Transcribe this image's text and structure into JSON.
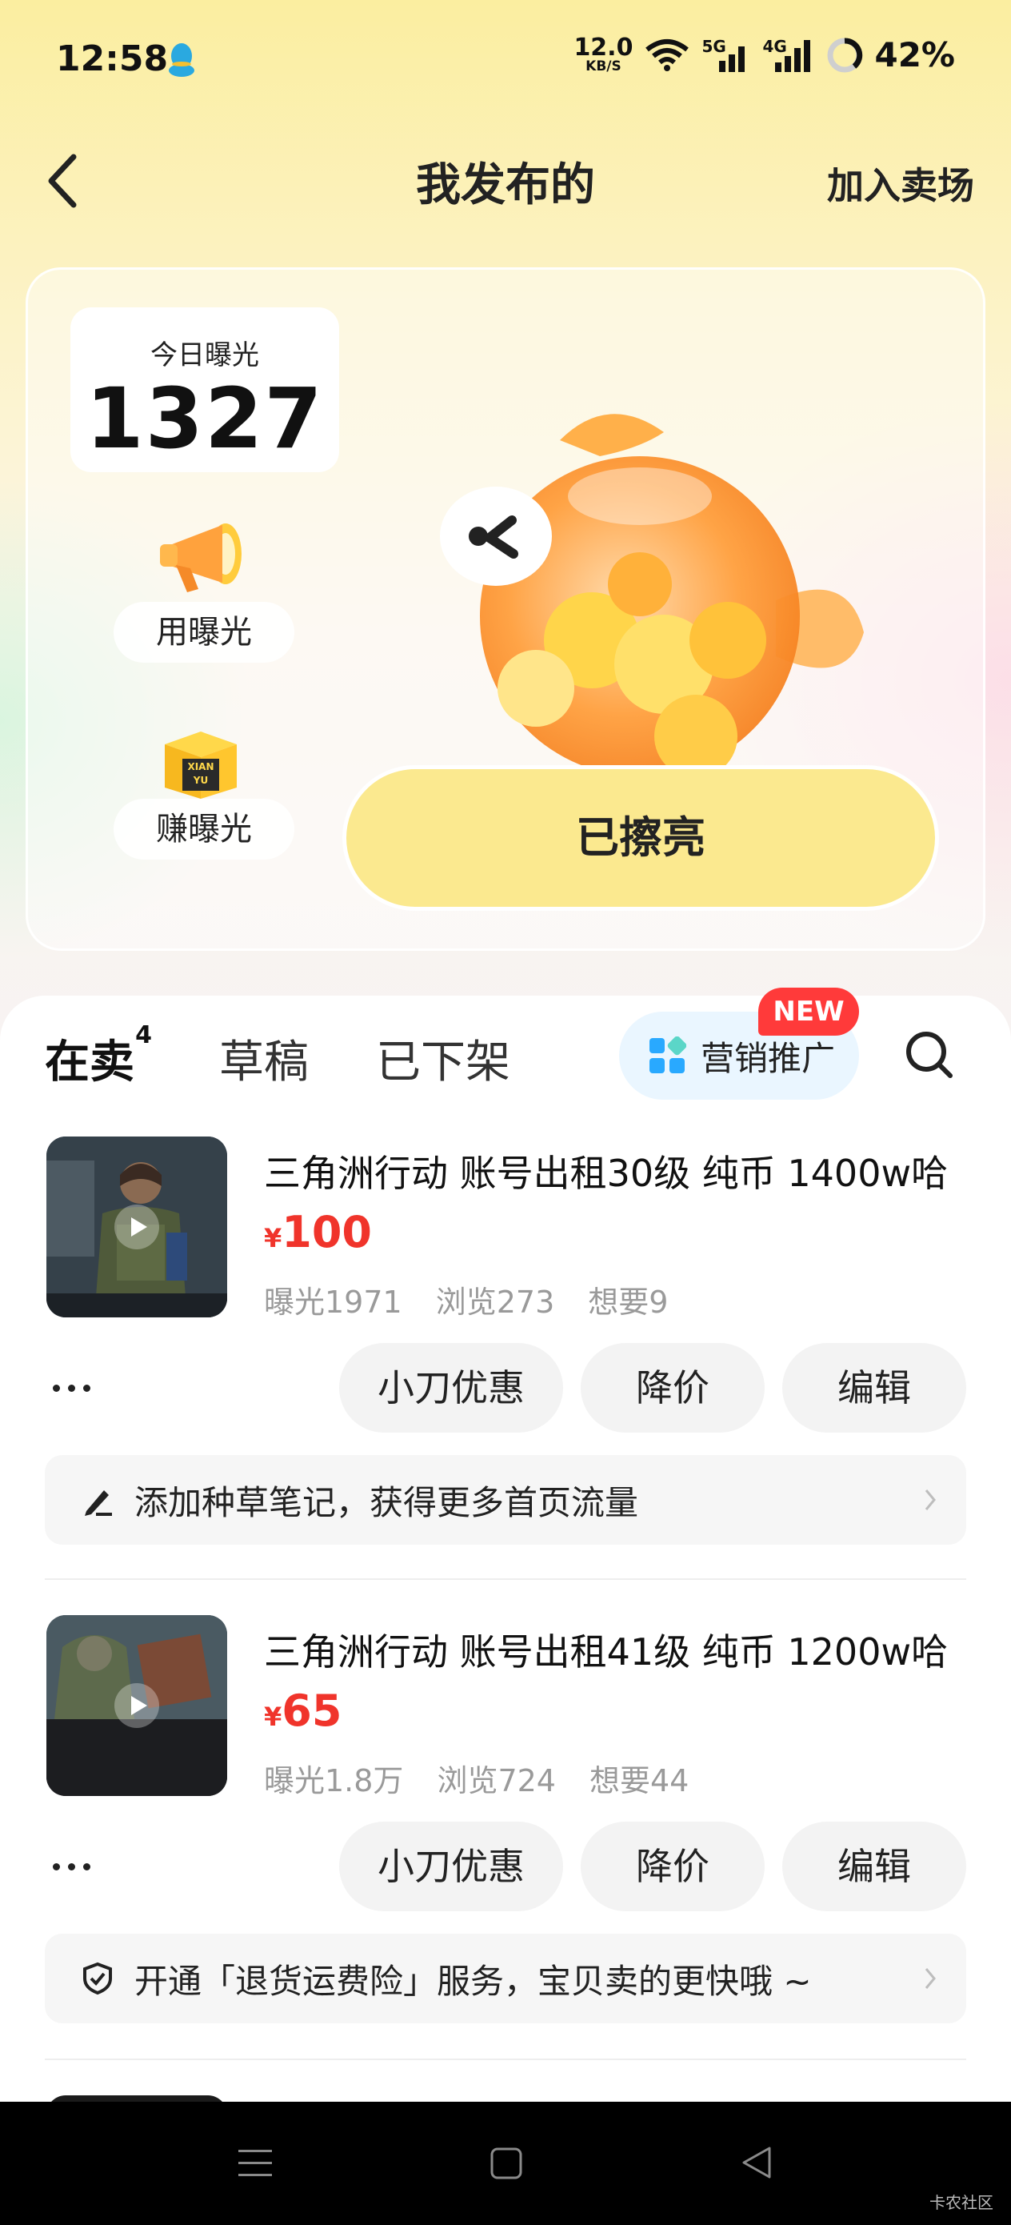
{
  "status_bar": {
    "time": "12:58",
    "net_speed_value": "12.0",
    "net_speed_unit": "KB/S",
    "signal1_label": "5G",
    "signal2_label": "4G",
    "battery": "42%"
  },
  "header": {
    "title": "我发布的",
    "join_label": "加入卖场"
  },
  "hero": {
    "today_exposure_label": "今日曝光",
    "today_exposure_value": "1327",
    "use_exposure_label": "用曝光",
    "earn_exposure_label": "赚曝光",
    "box_logo_line1": "XIAN",
    "box_logo_line2": "YU",
    "polish_button_label": "已擦亮"
  },
  "tabs": {
    "on_sale_label": "在卖",
    "on_sale_count": "4",
    "drafts_label": "草稿",
    "removed_label": "已下架",
    "promo_label": "营销推广",
    "new_badge": "NEW"
  },
  "listings": [
    {
      "title": "三角洲行动 账号出租30级 纯币 1400w哈",
      "currency": "¥",
      "price": "100",
      "exposure": "曝光1971",
      "views": "浏览273",
      "wants": "想要9",
      "btn_discount": "小刀优惠",
      "btn_reduce": "降价",
      "btn_edit": "编辑",
      "tip": "添加种草笔记，获得更多首页流量"
    },
    {
      "title": "三角洲行动 账号出租41级 纯币 1200w哈",
      "currency": "¥",
      "price": "65",
      "exposure": "曝光1.8万",
      "views": "浏览724",
      "wants": "想要44",
      "btn_discount": "小刀优惠",
      "btn_reduce": "降价",
      "btn_edit": "编辑",
      "tip": "开通「退货运费险」服务，宝贝卖的更快哦 ~"
    }
  ],
  "watermark": "卡农社区",
  "colors": {
    "accent_yellow": "#fbe98f",
    "price_red": "#f0342b",
    "badge_red": "#ff3a3a",
    "tab_highlight": "#ffe02b"
  },
  "icons": [
    "qq-penguin-icon",
    "wifi-icon",
    "signal-icon",
    "battery-icon",
    "back-arrow-icon",
    "megaphone-icon",
    "xianyu-box-icon",
    "fish-mascot",
    "grid-icon",
    "search-icon",
    "more-dots-icon",
    "pen-icon",
    "shield-check-icon",
    "chevron-right-icon",
    "nav-menu-icon",
    "nav-home-icon",
    "nav-back-icon"
  ]
}
